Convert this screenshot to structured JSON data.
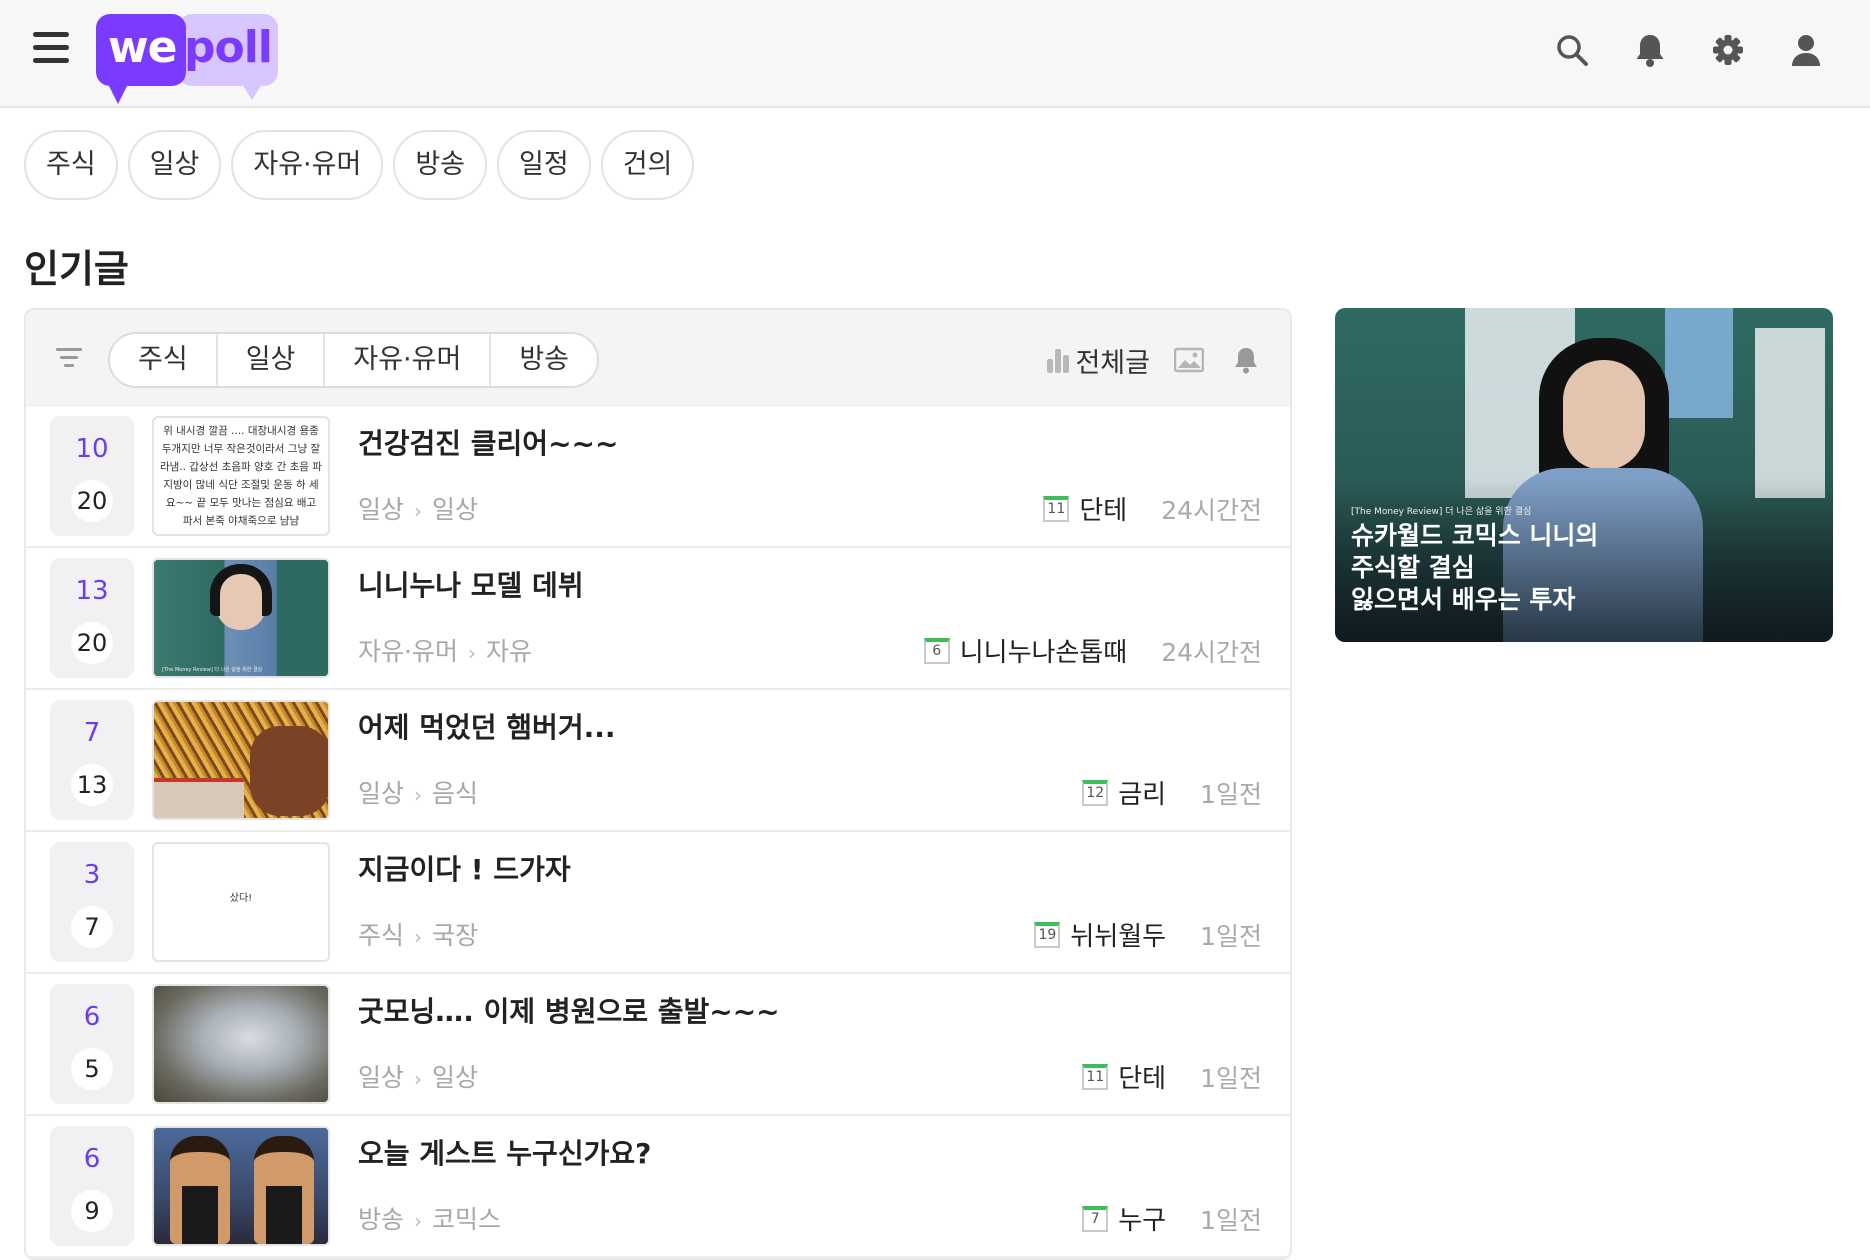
{
  "header": {
    "logo": {
      "part1": "we",
      "part2": "poll"
    },
    "icons": [
      "hamburger-icon",
      "search-icon",
      "bell-icon",
      "gear-icon",
      "user-icon"
    ]
  },
  "categories": [
    "주식",
    "일상",
    "자유·유머",
    "방송",
    "일정",
    "건의"
  ],
  "section_title": "인기글",
  "list_bar": {
    "segments": [
      "주식",
      "일상",
      "자유·유머",
      "방송"
    ],
    "all_posts_label": "전체글"
  },
  "posts": [
    {
      "up": "10",
      "comments": "20",
      "title": "건강검진 클리어~~~",
      "board": "일상",
      "sub": "일상",
      "level": "11",
      "author": "단테",
      "time": "24시간전",
      "thumb_text": "위 내시경 깔끔 .... 대장내시경 용종 두개지만 너무 작은것이라서 그냥 잘 라냄.. 갑상선 초음파 양호 간 초음 파 지방이 많네 식단 조절및 운동 하 세요~~ 끝 모두 맛나는 점심요 배고 파서 본죽 야채죽으로 냠냠"
    },
    {
      "up": "13",
      "comments": "20",
      "title": "니니누나 모델 데뷔",
      "board": "자유·유머",
      "sub": "자유",
      "level": "6",
      "author": "니니누나손톱때",
      "time": "24시간전",
      "thumb_text": "[The Money Review] 더 나은 삶을 위한 결심"
    },
    {
      "up": "7",
      "comments": "13",
      "title": "어제 먹었던 햄버거...",
      "board": "일상",
      "sub": "음식",
      "level": "12",
      "author": "금리",
      "time": "1일전",
      "thumb_text": ""
    },
    {
      "up": "3",
      "comments": "7",
      "title": "지금이다 ! 드가자",
      "board": "주식",
      "sub": "국장",
      "level": "19",
      "author": "뉘뉘월두",
      "time": "1일전",
      "thumb_text": "샀다!"
    },
    {
      "up": "6",
      "comments": "5",
      "title": "굿모닝…. 이제 병원으로 출발~~~",
      "board": "일상",
      "sub": "일상",
      "level": "11",
      "author": "단테",
      "time": "1일전",
      "thumb_text": ""
    },
    {
      "up": "6",
      "comments": "9",
      "title": "오늘 게스트 누구신가요?",
      "board": "방송",
      "sub": "코믹스",
      "level": "7",
      "author": "누구",
      "time": "1일전",
      "thumb_text": ""
    }
  ],
  "ad": {
    "small_text": "[The Money Review] 더 나은 삶을 위한 결심",
    "title_lines": [
      "슈카월드 코믹스 니니의",
      "주식할 결심",
      "잃으면서 배우는 투자"
    ]
  },
  "colors": {
    "brand": "#7b3bff",
    "brand_light": "#d7c6ff",
    "level_bar": "#3cbf5a"
  }
}
